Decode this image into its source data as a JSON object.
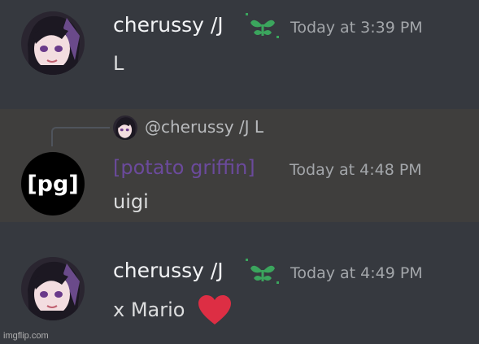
{
  "messages": [
    {
      "username": "cherussy /J",
      "timestamp": "Today at 3:39 PM",
      "content": "L"
    },
    {
      "reply_preview": "@cherussy /J L",
      "username": "[potato griffin]",
      "avatar_text": "[pg]",
      "timestamp": "Today at 4:48 PM",
      "content": "uigi",
      "username_color": "#6b4a9c"
    },
    {
      "username": "cherussy /J",
      "timestamp": "Today at 4:49 PM",
      "content": "x Mario"
    }
  ],
  "colors": {
    "background": "#36393f",
    "highlight": "#3f3e3d",
    "badge_green": "#3ba55d",
    "heart": "#dd2e44"
  },
  "icons": {
    "badge": "green-sprout-badge-icon",
    "heart": "red-heart-emoji"
  },
  "watermark": "imgflip.com"
}
